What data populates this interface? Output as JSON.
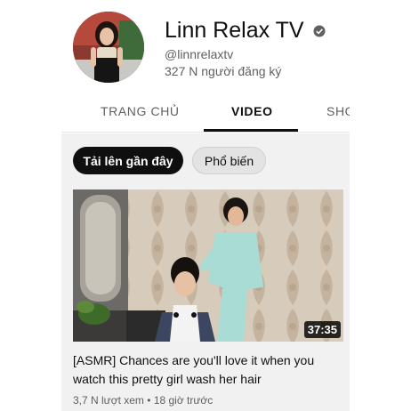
{
  "channel": {
    "name": "Linn Relax TV",
    "handle": "@linnrelaxtv",
    "subscribers": "327 N người đăng ký"
  },
  "tabs": [
    {
      "label": "TRANG CHỦ",
      "active": false
    },
    {
      "label": "VIDEO",
      "active": true
    },
    {
      "label": "SHO",
      "active": false
    }
  ],
  "filters": [
    {
      "label": "Tải lên gần đây",
      "selected": true
    },
    {
      "label": "Phổ biến",
      "selected": false
    }
  ],
  "video": {
    "duration": "37:35",
    "title": "[ASMR] Chances are you'll love it when you watch this pretty girl wash her hair",
    "views": "3,7 N lượt xem",
    "separator": "•",
    "age": "18 giờ trước"
  },
  "icons": {
    "verified": "verified-check-icon"
  },
  "colors": {
    "text_primary": "#0f0f0f",
    "text_secondary": "#606060",
    "panel_bg": "#f1f1f1",
    "chip_selected_bg": "#0f0f0f",
    "chip_bg": "#e3e3e3"
  }
}
